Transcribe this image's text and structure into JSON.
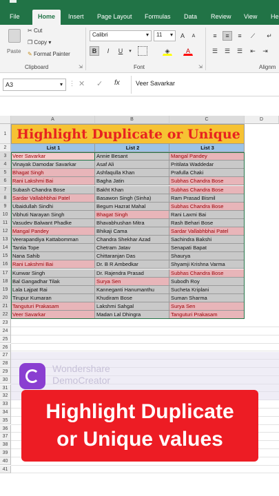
{
  "tabs": [
    "File",
    "Home",
    "Insert",
    "Page Layout",
    "Formulas",
    "Data",
    "Review",
    "View",
    "He"
  ],
  "clipboard": {
    "paste": "Paste",
    "cut": "Cut",
    "copy": "Copy",
    "format_painter": "Format Painter",
    "group": "Clipboard"
  },
  "font": {
    "name": "Calibri",
    "size": "11",
    "bold": "B",
    "italic": "I",
    "underline": "U",
    "group": "Font"
  },
  "alignment": {
    "group": "Alignm"
  },
  "namebox": "A3",
  "formula": "Veer Savarkar",
  "columns": [
    "A",
    "B",
    "C",
    "D"
  ],
  "title": "Highlight Duplicate or Unique",
  "headers": [
    "List 1",
    "List 2",
    "List 3"
  ],
  "rows": [
    [
      "Veer Savarkar",
      "Annie Besant",
      "Mangal Pandey"
    ],
    [
      "Vinayak Damodar Savarkar",
      "Asaf Ali",
      "Pritilata Waddedar"
    ],
    [
      "Bhagat Singh",
      "Ashfaqulla Khan",
      "Prafulla Chaki"
    ],
    [
      "Rani Lakshmi Bai",
      "Bagha Jatin",
      "Subhas Chandra Bose"
    ],
    [
      "Subash Chandra Bose",
      "Bakht Khan",
      "Subhas Chandra Bose"
    ],
    [
      "Sardar Vallabhbhai Patel",
      "Basawon Singh (Sinha)",
      "Ram Prasad Bismil"
    ],
    [
      "Ubaidullah Sindhi",
      "Begum Hazrat Mahal",
      "Subhas Chandra Bose"
    ],
    [
      "Vibhuti Narayan Singh",
      "Bhagat Singh",
      "Rani Laxmi Bai"
    ],
    [
      "Vasudev Balwant Phadke",
      "Bhavabhushan Mitra",
      "Rash Behari Bose"
    ],
    [
      "Mangal Pandey",
      "Bhikaji Cama",
      "Sardar Vallabhbhai Patel"
    ],
    [
      "Veerapandiya Kattabomman",
      "Chandra Shekhar Azad",
      "Sachindra Bakshi"
    ],
    [
      "Tantia Tope",
      "Chetram Jatav",
      "Senapati Bapat"
    ],
    [
      "Nana Sahib",
      "Chittaranjan Das",
      "Shaurya"
    ],
    [
      "Rani Lakshmi Bai",
      "Dr. B R Ambedkar",
      "Shyamji Krishna Varma"
    ],
    [
      "Kunwar Singh",
      "Dr. Rajendra Prasad",
      "Subhas Chandra Bose"
    ],
    [
      "Bal Gangadhar Tilak",
      "Surya Sen",
      "Subodh Roy"
    ],
    [
      "Lala Lajpat Rai",
      "Kanneganti Hanumanthu",
      "Sucheta Kriplani"
    ],
    [
      "Tirupur Kumaran",
      "Khudiram Bose",
      "Suman Sharma"
    ],
    [
      "Tanguturi Prakasam",
      "Lakshmi Sahgal",
      "Surya Sen"
    ],
    [
      "Veer Savarkar",
      "Madan Lal Dhingra",
      "Tanguturi Prakasam"
    ]
  ],
  "dup": [
    [
      1,
      0,
      1
    ],
    [
      0,
      0,
      0
    ],
    [
      1,
      0,
      0
    ],
    [
      1,
      0,
      1
    ],
    [
      0,
      0,
      1
    ],
    [
      1,
      0,
      0
    ],
    [
      0,
      0,
      1
    ],
    [
      0,
      1,
      0
    ],
    [
      0,
      0,
      0
    ],
    [
      1,
      0,
      1
    ],
    [
      0,
      0,
      0
    ],
    [
      0,
      0,
      0
    ],
    [
      0,
      0,
      0
    ],
    [
      1,
      0,
      0
    ],
    [
      0,
      0,
      1
    ],
    [
      0,
      1,
      0
    ],
    [
      0,
      0,
      0
    ],
    [
      0,
      0,
      0
    ],
    [
      1,
      0,
      1
    ],
    [
      1,
      0,
      1
    ]
  ],
  "row_numbers": [
    "1",
    "2",
    "3",
    "4",
    "5",
    "6",
    "7",
    "8",
    "9",
    "10",
    "11",
    "12",
    "13",
    "14",
    "15",
    "16",
    "17",
    "18",
    "19",
    "20",
    "21",
    "22",
    "23",
    "24",
    "25",
    "26",
    "27",
    "28",
    "29",
    "30",
    "31",
    "32",
    "33",
    "34",
    "35",
    "36",
    "37",
    "38",
    "39",
    "40",
    "41"
  ],
  "watermark": {
    "brand": "Wondershare",
    "product": "DemoCreator"
  },
  "banner": {
    "line1": "Highlight Duplicate",
    "line2": "or Unique values"
  },
  "colors": {
    "excel_green": "#217346",
    "title_red": "#e8231f",
    "title_bg": "#f6c233",
    "header_blue": "#9dc3e6",
    "dup_pink": "#e8b5b9",
    "dup_text": "#9c0006",
    "cell_gray": "#c9c9c9",
    "banner_red": "#ed1c24"
  }
}
